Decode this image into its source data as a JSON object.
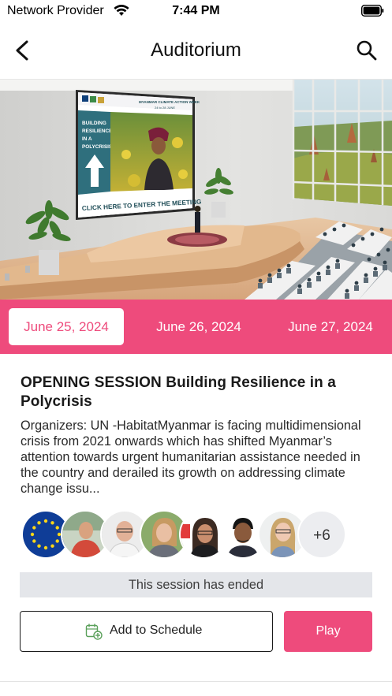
{
  "status_bar": {
    "carrier": "Network Provider",
    "time": "7:44 PM"
  },
  "nav": {
    "title": "Auditorium"
  },
  "hero": {
    "screen_header": "MYANMAR CLIMATE ACTION WEEK",
    "screen_dates": "24 to 28 JUNE",
    "screen_headline": [
      "BUILDING",
      "RESILIENCE",
      "IN A",
      "POLYCRISIS"
    ],
    "screen_cta": "CLICK HERE TO ENTER THE MEETING"
  },
  "dates": {
    "tabs": [
      {
        "label": "June 25, 2024",
        "active": true
      },
      {
        "label": "June 26, 2024",
        "active": false
      },
      {
        "label": "June 27, 2024",
        "active": false
      }
    ]
  },
  "session": {
    "title": "OPENING SESSION Building Resilience in a Polycrisis",
    "description": "Organizers: UN -HabitatMyanmar is facing multidimensional crisis from 2021 onwards which has shifted Myanmar’s attention towards urgent humanitarian assistance needed in the country and derailed its growth on addressing climate change issu...",
    "speakers_more": "+6",
    "status": "This session has ended",
    "add_label": "Add to Schedule",
    "play_label": "Play"
  },
  "colors": {
    "accent": "#ee4b7c",
    "banner_bg": "#e4e6ea"
  }
}
